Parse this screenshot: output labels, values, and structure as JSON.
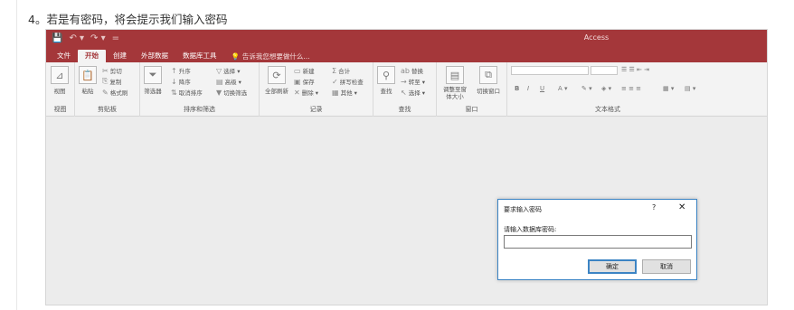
{
  "caption": "4。若是有密码，将会提示我们输入密码",
  "window": {
    "title": "Access",
    "qat": [
      "💾",
      "↶ ▾",
      "↷ ▾",
      "="
    ]
  },
  "tabs": [
    "文件",
    "开始",
    "创建",
    "外部数据",
    "数据库工具"
  ],
  "active_tab": "开始",
  "tell_me": "告诉我您想要做什么...",
  "ribbon": {
    "views": {
      "view": "视图",
      "label": "视图"
    },
    "clipboard": {
      "paste": "粘贴",
      "cut": "剪切",
      "copy": "复制",
      "format_painter": "格式刷",
      "label": "剪贴板"
    },
    "sort_filter": {
      "filter": "筛选器",
      "ascending": "升序",
      "descending": "降序",
      "remove_sort": "取消排序",
      "selection": "选择 ▾",
      "advanced": "高级 ▾",
      "toggle_filter": "切换筛选",
      "label": "排序和筛选"
    },
    "records": {
      "refresh_all": "全部刷新",
      "new": "新建",
      "save": "保存",
      "delete": "删除 ▾",
      "totals": "合计",
      "spelling": "拼写检查",
      "more": "其他 ▾",
      "label": "记录"
    },
    "find": {
      "find": "查找",
      "replace": "替换",
      "goto": "转至 ▾",
      "select": "选择 ▾",
      "label": "查找"
    },
    "window": {
      "size_to_fit": "调整至窗体大小",
      "switch_windows": "切换窗口",
      "label": "窗口"
    },
    "text_format": {
      "bold": "B",
      "italic": "I",
      "underline": "U",
      "label": "文本格式"
    }
  },
  "dialog": {
    "title": "要求输入密码",
    "help": "?",
    "close": "✕",
    "prompt": "请输入数据库密码:",
    "password_value": "",
    "ok": "确定",
    "cancel": "取消"
  },
  "colors": {
    "access_red": "#a4373a",
    "accent_blue": "#3c84c4"
  }
}
